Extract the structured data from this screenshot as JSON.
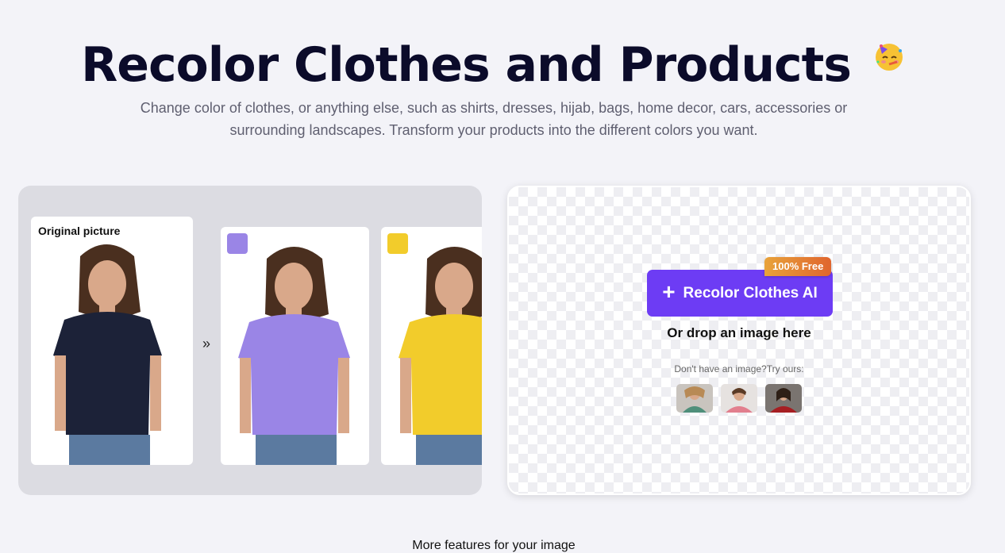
{
  "hero": {
    "title": "Recolor Clothes and Products",
    "emoji_icon": "party-face-icon",
    "subtitle": "Change color of clothes, or anything else, such as shirts, dresses, hijab, bags, home decor, cars, accessories or surrounding landscapes. Transform your products into the different colors you want."
  },
  "demo": {
    "original_label": "Original picture",
    "arrow": "»",
    "shirt_colors": {
      "original": "#1c2238",
      "purple": "#9a85e6",
      "yellow": "#f2cc2b"
    }
  },
  "upload": {
    "button_label": "Recolor Clothes AI",
    "button_icon": "plus-icon",
    "badge": "100% Free",
    "drop_text": "Or drop an image here",
    "try_text": "Don't have an image?Try ours:",
    "accent": "#6d3cf4"
  },
  "footer": {
    "more_text": "More features for your image"
  }
}
